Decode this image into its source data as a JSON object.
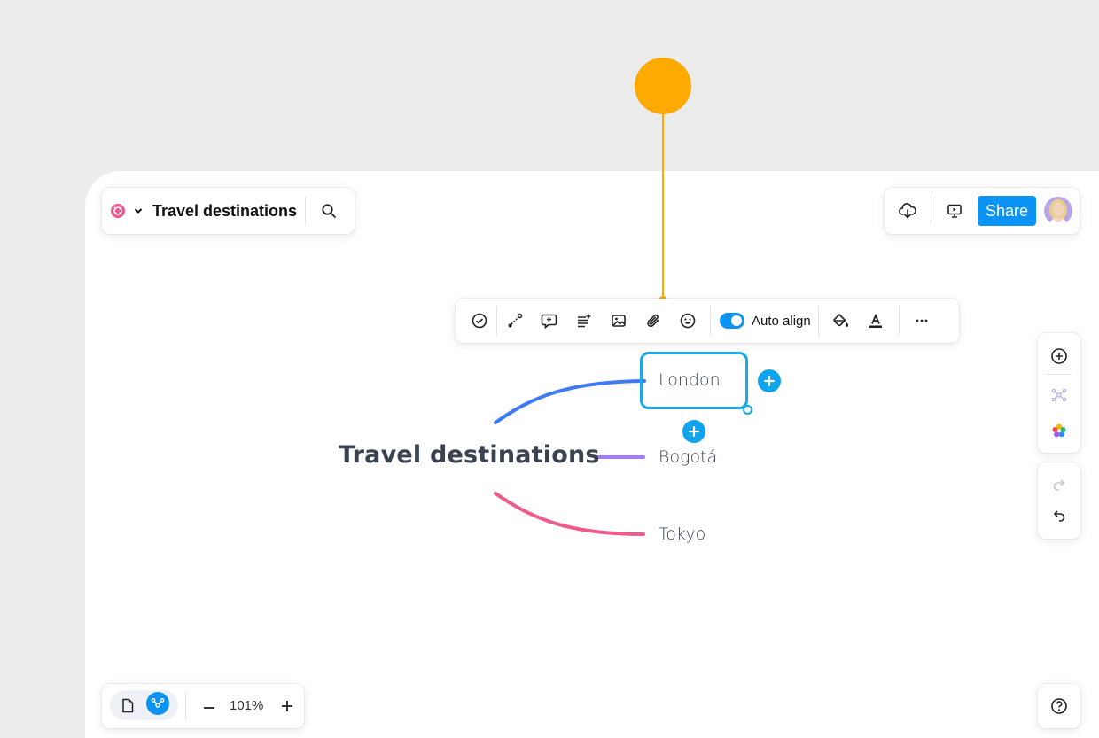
{
  "document": {
    "title": "Travel destinations"
  },
  "header_right": {
    "share_label": "Share"
  },
  "toolbar": {
    "auto_align_label": "Auto align",
    "auto_align_on": true
  },
  "mindmap": {
    "root": "Travel destinations",
    "children": [
      {
        "label": "London",
        "color": "#3f7af3",
        "selected": true
      },
      {
        "label": "Bogotá",
        "color": "#a27cf0"
      },
      {
        "label": "Tokyo",
        "color": "#ef5b8c"
      }
    ]
  },
  "zoom": {
    "label": "101%"
  },
  "colors": {
    "accent": "#0b93f6",
    "selection": "#1aa7ec",
    "annotation": "#ffaa00"
  },
  "icons": {
    "toolbar": [
      "check-circle-icon",
      "connector-icon",
      "comment-icon",
      "notes-icon",
      "image-icon",
      "attachment-icon",
      "emoji-icon",
      "fill-icon",
      "text-color-icon",
      "more-icon"
    ],
    "right_panel": [
      "add-circle-icon",
      "mindmap-layout-icon",
      "color-palette-icon",
      "redo-icon",
      "undo-icon"
    ]
  }
}
